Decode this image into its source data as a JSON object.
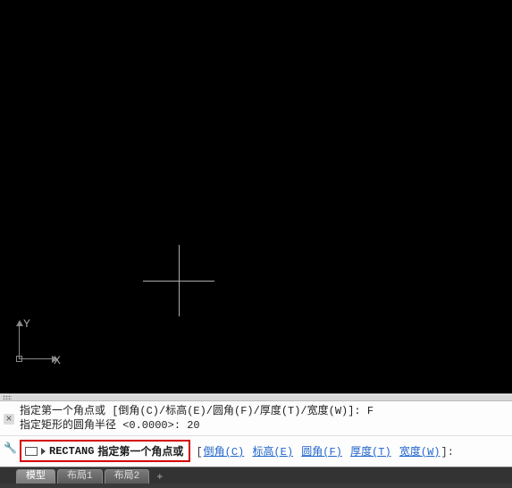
{
  "ucs": {
    "x_label": "X",
    "y_label": "Y"
  },
  "history": {
    "line1_prefix": "指定第一个角点或 [倒角(C)/标高(E)/圆角(F)/厚度(T)/宽度(W)]: ",
    "line1_input": "F",
    "line2_prefix": "指定矩形的圆角半径 ",
    "line2_default": "<0.0000>: ",
    "line2_input": "20"
  },
  "command": {
    "name": "RECTANG",
    "prompt": "指定第一个角点或",
    "options_open": " [",
    "options_close": "]:",
    "options": [
      {
        "label": "倒角",
        "key": "C"
      },
      {
        "label": "标高",
        "key": "E"
      },
      {
        "label": "圆角",
        "key": "F"
      },
      {
        "label": "厚度",
        "key": "T"
      },
      {
        "label": "宽度",
        "key": "W"
      }
    ]
  },
  "tabs": {
    "items": [
      "模型",
      "布局1",
      "布局2"
    ],
    "active_index": 0,
    "plus": "+"
  },
  "icons": {
    "close": "×",
    "wrench": "🔧"
  }
}
